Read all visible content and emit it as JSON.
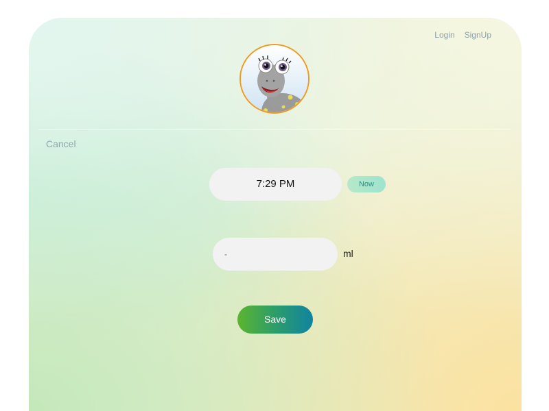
{
  "nav": {
    "login_label": "Login",
    "signup_label": "SignUp"
  },
  "avatar": {
    "icon": "dinosaur-mascot-icon"
  },
  "form": {
    "cancel_label": "Cancel",
    "time_value": "7:29 PM",
    "now_label": "Now",
    "amount_value": "-",
    "unit_label": "ml",
    "save_label": "Save"
  },
  "colors": {
    "avatar_border": "#f19a1f",
    "save_gradient_start": "#5cb42f",
    "save_gradient_end": "#1183a0",
    "now_button": "#a8e6cc",
    "input_background": "#f2f2f2"
  }
}
